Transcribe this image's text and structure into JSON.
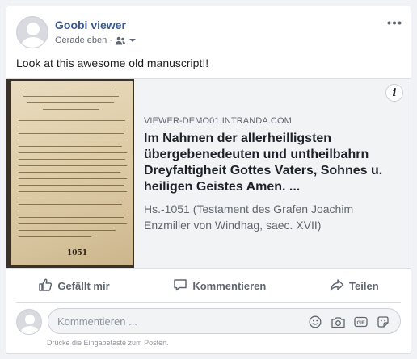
{
  "post": {
    "page_name": "Goobi viewer",
    "timestamp": "Gerade eben",
    "separator": "·",
    "audience_icon": "people-icon",
    "more_icon": "more-icon",
    "text": "Look at this awesome old manuscript!!"
  },
  "attachment": {
    "thumbnail_number": "1051",
    "info_icon": "info-icon",
    "info_glyph": "i",
    "domain": "VIEWER-DEMO01.INTRANDA.COM",
    "title": "Im Nahmen der allerheilligsten übergebenedeuten und untheilbahrn Dreyfaltigheit Gottes Vaters, Sohnes u. heiligen Geistes Amen. ...",
    "description": "Hs.-1051 (Testament des Grafen Joachim Enzmiller von Windhag, saec. XVII)"
  },
  "actions": {
    "like": "Gefällt mir",
    "comment": "Kommentieren",
    "share": "Teilen"
  },
  "comment_input": {
    "placeholder": "Kommentieren ...",
    "value": "",
    "icons": [
      "emoji-icon",
      "camera-icon",
      "gif-icon",
      "sticker-icon"
    ],
    "hint": "Drücke die Eingabetaste zum Posten."
  },
  "colors": {
    "link_blue": "#385898",
    "secondary_text": "#606770",
    "background": "#f0f2f5"
  }
}
